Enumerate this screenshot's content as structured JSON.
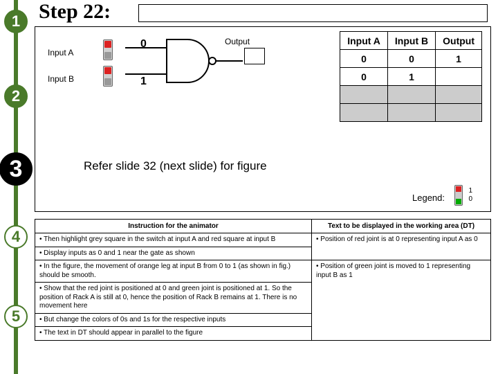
{
  "step_label": "Step 22:",
  "badges": {
    "n1": "1",
    "n2": "2",
    "n3": "3",
    "n4": "4",
    "n5": "5"
  },
  "circuit": {
    "inputA_label": "Input A",
    "inputB_label": "Input B",
    "output_label": "Output",
    "valA": "0",
    "valB": "1"
  },
  "truth": {
    "hA": "Input A",
    "hB": "Input B",
    "hO": "Output",
    "r1": {
      "a": "0",
      "b": "0",
      "o": "1"
    },
    "r2": {
      "a": "0",
      "b": "1",
      "o": ""
    }
  },
  "refer": "Refer slide 32 (next slide) for figure",
  "legend": {
    "label": "Legend:",
    "one": "1",
    "zero": "0"
  },
  "instr": {
    "h1": "Instruction for the animator",
    "h2": "Text to be displayed in the working area (DT)",
    "left": [
      "Then highlight grey square in the switch at input A and red square at input B",
      "Display inputs as 0 and 1 near the gate as shown",
      "In the figure, the movement of orange leg at input B from 0 to 1 (as shown in fig.) should be smooth.",
      "Show that the red joint is positioned at 0 and green joint is positioned at 1. So the position of Rack A is still at 0, hence the position of Rack B remains at 1. There is no movement here",
      "But change the colors of 0s and 1s for the respective inputs",
      "The text in DT should appear in parallel to the figure"
    ],
    "right": [
      "Position of  red joint is at 0 representing input A as 0",
      "Position of  green joint is moved to 1 representing input B as 1"
    ]
  },
  "chart_data": {
    "type": "table",
    "title": "NAND truth table (partial)",
    "columns": [
      "Input A",
      "Input B",
      "Output"
    ],
    "rows": [
      [
        0,
        0,
        1
      ],
      [
        0,
        1,
        null
      ],
      [
        null,
        null,
        null
      ],
      [
        null,
        null,
        null
      ]
    ]
  }
}
